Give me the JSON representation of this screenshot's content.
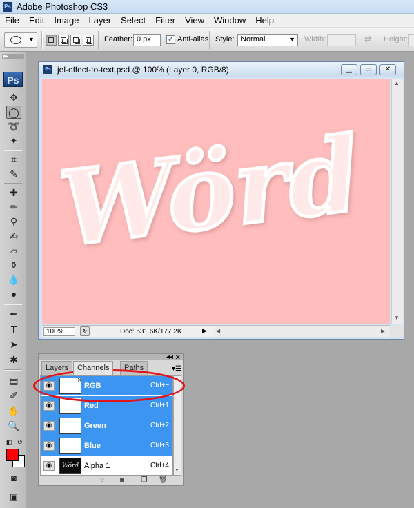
{
  "app": {
    "title": "Adobe Photoshop CS3",
    "icon_text": "Ps"
  },
  "menu": [
    "File",
    "Edit",
    "Image",
    "Layer",
    "Select",
    "Filter",
    "View",
    "Window",
    "Help"
  ],
  "options": {
    "feather_label": "Feather:",
    "feather_value": "0 px",
    "antialias_label": "Anti-alias",
    "antialias_checked": true,
    "style_label": "Style:",
    "style_value": "Normal",
    "width_label": "Width:",
    "height_label": "Height:"
  },
  "toolbox": {
    "logo": "Ps",
    "foreground_color": "#ff0000",
    "background_color": "#ffffff"
  },
  "document": {
    "title": "jel-effect-to-text.psd @ 100% (Layer 0, RGB/8)",
    "canvas_color": "#ffbdbd",
    "canvas_text": "Wörd",
    "zoom": "100%",
    "doc_size": "Doc: 531.6K/177.2K"
  },
  "panel": {
    "tabs": [
      "Layers",
      "Channels",
      "Paths"
    ],
    "active_tab": "Channels",
    "channels": [
      {
        "name": "RGB",
        "shortcut": "Ctrl+~",
        "selected": true
      },
      {
        "name": "Red",
        "shortcut": "Ctrl+1",
        "selected": true
      },
      {
        "name": "Green",
        "shortcut": "Ctrl+2",
        "selected": true
      },
      {
        "name": "Blue",
        "shortcut": "Ctrl+3",
        "selected": true
      },
      {
        "name": "Alpha 1",
        "shortcut": "Ctrl+4",
        "selected": false,
        "thumb_text": "Wörd"
      }
    ]
  },
  "colors": {
    "selection": "#3d95f2",
    "annotation": "#e1141b"
  }
}
